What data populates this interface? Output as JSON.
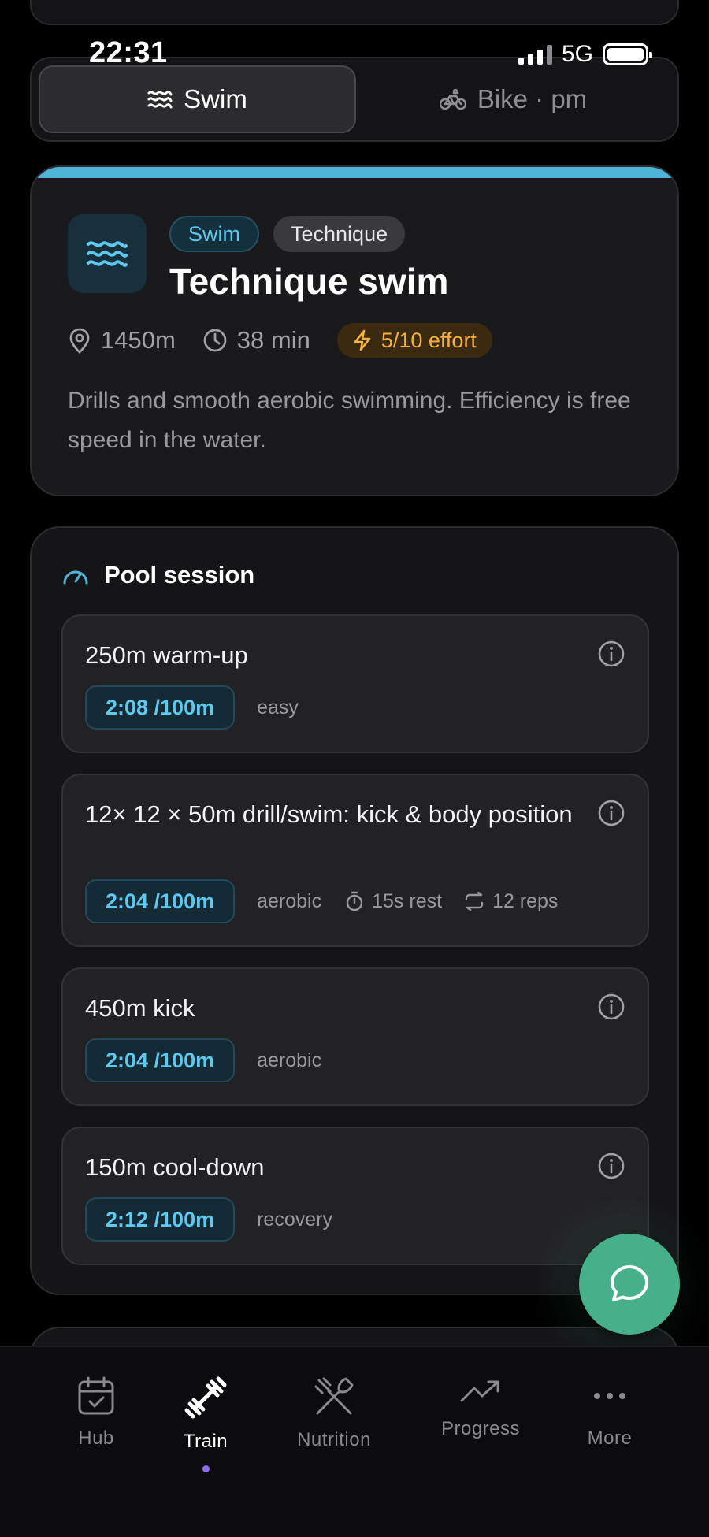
{
  "status_bar": {
    "time": "22:31",
    "network": "5G"
  },
  "tabs": [
    {
      "label": "Swim",
      "icon": "waves-icon",
      "active": true
    },
    {
      "label": "Bike · pm",
      "icon": "bicycle-icon",
      "active": false
    }
  ],
  "workout": {
    "accent_color": "#4fb4d8",
    "tags": [
      "Swim",
      "Technique"
    ],
    "title": "Technique swim",
    "distance": "1450m",
    "duration": "38 min",
    "effort": "5/10 effort",
    "description": "Drills and smooth aerobic swimming. Efficiency is free speed in the water."
  },
  "session": {
    "title": "Pool session",
    "intervals": [
      {
        "name": "250m warm-up",
        "pace": "2:08 /100m",
        "zone": "easy"
      },
      {
        "name": "12× 12 × 50m drill/swim: kick & body position",
        "pace": "2:04 /100m",
        "zone": "aerobic",
        "rest": "15s rest",
        "reps": "12 reps"
      },
      {
        "name": "450m kick",
        "pace": "2:04 /100m",
        "zone": "aerobic"
      },
      {
        "name": "150m cool-down",
        "pace": "2:12 /100m",
        "zone": "recovery"
      }
    ]
  },
  "fab": {
    "icon": "chat-bubble-icon",
    "color": "#46b08a"
  },
  "nav": [
    {
      "label": "Hub",
      "icon": "calendar-icon"
    },
    {
      "label": "Train",
      "icon": "dumbbell-icon",
      "active": true
    },
    {
      "label": "Nutrition",
      "icon": "utensils-icon"
    },
    {
      "label": "Progress",
      "icon": "trend-up-icon"
    },
    {
      "label": "More",
      "icon": "more-dots-icon"
    }
  ]
}
